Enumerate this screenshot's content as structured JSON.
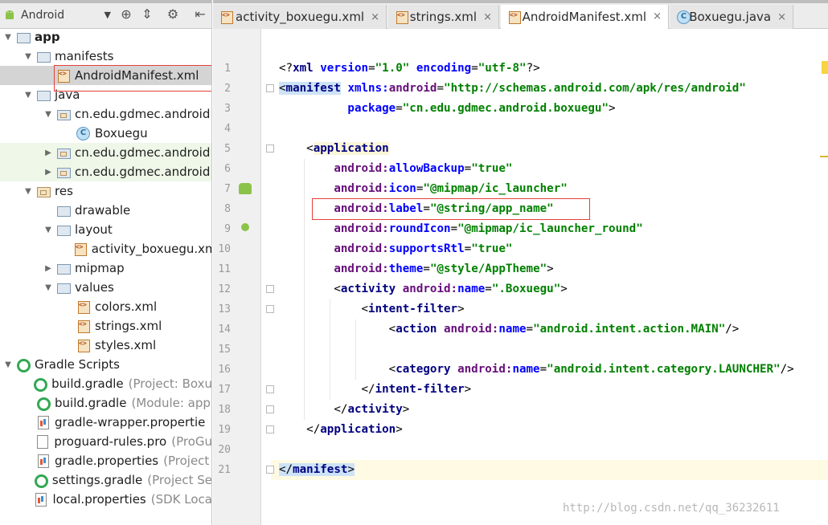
{
  "project_panel": {
    "view_selector": "Android",
    "tree": [
      {
        "label": "app",
        "hint": "",
        "depth": 0,
        "arrow": "down",
        "icon": "module-folder-icon",
        "bold": true
      },
      {
        "label": "manifests",
        "hint": "",
        "depth": 1,
        "arrow": "down",
        "icon": "folder-icon"
      },
      {
        "label": "AndroidManifest.xml",
        "hint": "",
        "depth": 2,
        "arrow": "none",
        "icon": "xml-file-icon",
        "selected": true
      },
      {
        "label": "java",
        "hint": "",
        "depth": 1,
        "arrow": "down",
        "icon": "source-folder-icon"
      },
      {
        "label": "cn.edu.gdmec.android",
        "hint": "",
        "depth": 2,
        "arrow": "down",
        "icon": "package-icon"
      },
      {
        "label": "Boxuegu",
        "hint": "",
        "depth": 3,
        "arrow": "none",
        "icon": "java-class-icon"
      },
      {
        "label": "cn.edu.gdmec.android",
        "hint": "",
        "depth": 2,
        "arrow": "right",
        "icon": "package-icon",
        "tinted": true
      },
      {
        "label": "cn.edu.gdmec.android",
        "hint": "",
        "depth": 2,
        "arrow": "right",
        "icon": "package-icon",
        "tinted": true
      },
      {
        "label": "res",
        "hint": "",
        "depth": 1,
        "arrow": "down",
        "icon": "resource-folder-icon"
      },
      {
        "label": "drawable",
        "hint": "",
        "depth": 2,
        "arrow": "none",
        "icon": "folder-icon"
      },
      {
        "label": "layout",
        "hint": "",
        "depth": 2,
        "arrow": "down",
        "icon": "folder-icon"
      },
      {
        "label": "activity_boxuegu.xml",
        "hint": "",
        "depth": 3,
        "arrow": "none",
        "icon": "xml-file-icon"
      },
      {
        "label": "mipmap",
        "hint": "",
        "depth": 2,
        "arrow": "right",
        "icon": "folder-icon"
      },
      {
        "label": "values",
        "hint": "",
        "depth": 2,
        "arrow": "down",
        "icon": "folder-icon"
      },
      {
        "label": "colors.xml",
        "hint": "",
        "depth": 3,
        "arrow": "none",
        "icon": "xml-file-icon"
      },
      {
        "label": "strings.xml",
        "hint": "",
        "depth": 3,
        "arrow": "none",
        "icon": "xml-file-icon"
      },
      {
        "label": "styles.xml",
        "hint": "",
        "depth": 3,
        "arrow": "none",
        "icon": "xml-file-icon"
      },
      {
        "label": "Gradle Scripts",
        "hint": "",
        "depth": 0,
        "arrow": "down",
        "icon": "gradle-icon"
      },
      {
        "label": "build.gradle",
        "hint": "(Project: Boxu",
        "depth": 1,
        "arrow": "none",
        "icon": "gradle-script-icon"
      },
      {
        "label": "build.gradle",
        "hint": "(Module: app",
        "depth": 1,
        "arrow": "none",
        "icon": "gradle-script-icon"
      },
      {
        "label": "gradle-wrapper.propertie",
        "hint": "",
        "depth": 1,
        "arrow": "none",
        "icon": "properties-file-icon"
      },
      {
        "label": "proguard-rules.pro",
        "hint": "(ProGu",
        "depth": 1,
        "arrow": "none",
        "icon": "text-file-icon"
      },
      {
        "label": "gradle.properties",
        "hint": "(Project",
        "depth": 1,
        "arrow": "none",
        "icon": "properties-file-icon"
      },
      {
        "label": "settings.gradle",
        "hint": "(Project Se",
        "depth": 1,
        "arrow": "none",
        "icon": "gradle-script-icon"
      },
      {
        "label": "local.properties",
        "hint": "(SDK Loca",
        "depth": 1,
        "arrow": "none",
        "icon": "properties-file-icon"
      }
    ]
  },
  "tabs": [
    {
      "label": "activity_boxuegu.xml",
      "icon": "xml-file-icon",
      "active": false
    },
    {
      "label": "strings.xml",
      "icon": "xml-file-icon",
      "active": false
    },
    {
      "label": "AndroidManifest.xml",
      "icon": "xml-file-icon",
      "active": true
    },
    {
      "label": "Boxuegu.java",
      "icon": "java-class-icon",
      "active": false
    }
  ],
  "tab_close_glyph": "×",
  "editor": {
    "line_numbers": [
      "1",
      "2",
      "3",
      "4",
      "5",
      "6",
      "7",
      "8",
      "9",
      "10",
      "11",
      "12",
      "13",
      "14",
      "15",
      "16",
      "17",
      "18",
      "19",
      "20",
      "21"
    ],
    "lines": [
      [
        {
          "t": "<?",
          "c": "br"
        },
        {
          "t": "xml ",
          "c": "tag"
        },
        {
          "t": "version",
          "c": "attr"
        },
        {
          "t": "=",
          "c": "br"
        },
        {
          "t": "\"1.0\"",
          "c": "val"
        },
        {
          "t": " ",
          "c": "br"
        },
        {
          "t": "encoding",
          "c": "attr"
        },
        {
          "t": "=",
          "c": "br"
        },
        {
          "t": "\"utf-8\"",
          "c": "val"
        },
        {
          "t": "?>",
          "c": "br"
        }
      ],
      [
        {
          "t": "<",
          "c": "br hl-tag"
        },
        {
          "t": "manifest",
          "c": "tag hl-tag"
        },
        {
          "t": " ",
          "c": "br"
        },
        {
          "t": "xmlns:",
          "c": "attr"
        },
        {
          "t": "android",
          "c": "ns"
        },
        {
          "t": "=",
          "c": "br"
        },
        {
          "t": "\"http://schemas.android.com/apk/res/android\"",
          "c": "val"
        }
      ],
      [
        {
          "t": "          ",
          "c": "br"
        },
        {
          "t": "package",
          "c": "attr"
        },
        {
          "t": "=",
          "c": "br"
        },
        {
          "t": "\"cn.edu.gdmec.android.boxuegu\"",
          "c": "val"
        },
        {
          "t": ">",
          "c": "br"
        }
      ],
      [
        {
          "t": "",
          "c": "br"
        }
      ],
      [
        {
          "t": "    ",
          "c": "br"
        },
        {
          "t": "<",
          "c": "br"
        },
        {
          "t": "application",
          "c": "tag app-hl"
        }
      ],
      [
        {
          "t": "        ",
          "c": "br"
        },
        {
          "t": "android:",
          "c": "ns"
        },
        {
          "t": "allowBackup",
          "c": "attr"
        },
        {
          "t": "=",
          "c": "br"
        },
        {
          "t": "\"true\"",
          "c": "val"
        }
      ],
      [
        {
          "t": "        ",
          "c": "br"
        },
        {
          "t": "android:",
          "c": "ns"
        },
        {
          "t": "icon",
          "c": "attr"
        },
        {
          "t": "=",
          "c": "br"
        },
        {
          "t": "\"@mipmap/ic_launcher\"",
          "c": "val"
        }
      ],
      [
        {
          "t": "        ",
          "c": "br"
        },
        {
          "t": "android:",
          "c": "ns"
        },
        {
          "t": "label",
          "c": "attr"
        },
        {
          "t": "=",
          "c": "br"
        },
        {
          "t": "\"@string/app_name\"",
          "c": "val"
        }
      ],
      [
        {
          "t": "        ",
          "c": "br"
        },
        {
          "t": "android:",
          "c": "ns"
        },
        {
          "t": "roundIcon",
          "c": "attr"
        },
        {
          "t": "=",
          "c": "br"
        },
        {
          "t": "\"@mipmap/ic_launcher_round\"",
          "c": "val"
        }
      ],
      [
        {
          "t": "        ",
          "c": "br"
        },
        {
          "t": "android:",
          "c": "ns"
        },
        {
          "t": "supportsRtl",
          "c": "attr"
        },
        {
          "t": "=",
          "c": "br"
        },
        {
          "t": "\"true\"",
          "c": "val"
        }
      ],
      [
        {
          "t": "        ",
          "c": "br"
        },
        {
          "t": "android:",
          "c": "ns"
        },
        {
          "t": "theme",
          "c": "attr"
        },
        {
          "t": "=",
          "c": "br"
        },
        {
          "t": "\"@style/AppTheme\"",
          "c": "val"
        },
        {
          "t": ">",
          "c": "br"
        }
      ],
      [
        {
          "t": "        ",
          "c": "br"
        },
        {
          "t": "<",
          "c": "br"
        },
        {
          "t": "activity ",
          "c": "tag"
        },
        {
          "t": "android:",
          "c": "ns"
        },
        {
          "t": "name",
          "c": "attr"
        },
        {
          "t": "=",
          "c": "br"
        },
        {
          "t": "\".Boxuegu\"",
          "c": "val"
        },
        {
          "t": ">",
          "c": "br"
        }
      ],
      [
        {
          "t": "            ",
          "c": "br"
        },
        {
          "t": "<",
          "c": "br"
        },
        {
          "t": "intent-filter",
          "c": "tag"
        },
        {
          "t": ">",
          "c": "br"
        }
      ],
      [
        {
          "t": "                ",
          "c": "br"
        },
        {
          "t": "<",
          "c": "br"
        },
        {
          "t": "action ",
          "c": "tag"
        },
        {
          "t": "android:",
          "c": "ns"
        },
        {
          "t": "name",
          "c": "attr"
        },
        {
          "t": "=",
          "c": "br"
        },
        {
          "t": "\"android.intent.action.MAIN\"",
          "c": "val"
        },
        {
          "t": "/>",
          "c": "br"
        }
      ],
      [
        {
          "t": "",
          "c": "br"
        }
      ],
      [
        {
          "t": "                ",
          "c": "br"
        },
        {
          "t": "<",
          "c": "br"
        },
        {
          "t": "category ",
          "c": "tag"
        },
        {
          "t": "android:",
          "c": "ns"
        },
        {
          "t": "name",
          "c": "attr"
        },
        {
          "t": "=",
          "c": "br"
        },
        {
          "t": "\"android.intent.category.LAUNCHER\"",
          "c": "val"
        },
        {
          "t": "/>",
          "c": "br"
        }
      ],
      [
        {
          "t": "            ",
          "c": "br"
        },
        {
          "t": "</",
          "c": "br"
        },
        {
          "t": "intent-filter",
          "c": "tag"
        },
        {
          "t": ">",
          "c": "br"
        }
      ],
      [
        {
          "t": "        ",
          "c": "br"
        },
        {
          "t": "</",
          "c": "br"
        },
        {
          "t": "activity",
          "c": "tag"
        },
        {
          "t": ">",
          "c": "br"
        }
      ],
      [
        {
          "t": "    ",
          "c": "br"
        },
        {
          "t": "</",
          "c": "br"
        },
        {
          "t": "application",
          "c": "tag"
        },
        {
          "t": ">",
          "c": "br"
        }
      ],
      [
        {
          "t": "",
          "c": "br"
        }
      ],
      [
        {
          "t": "</",
          "c": "br hl-tag"
        },
        {
          "t": "manifest",
          "c": "tag hl-tag"
        },
        {
          "t": ">",
          "c": "br hl-tag"
        }
      ]
    ],
    "folded_lines": [
      2,
      5,
      12,
      13,
      17,
      18,
      19,
      21
    ],
    "gutter_icon_lines": [
      7,
      9
    ],
    "current_line": 21
  },
  "watermark": "http://blog.csdn.net/qq_36232611",
  "colors": {
    "tag": "#000080",
    "attr": "#0000ff",
    "namespace": "#660e7a",
    "value": "#008000",
    "annotation_box": "#e5403a"
  }
}
